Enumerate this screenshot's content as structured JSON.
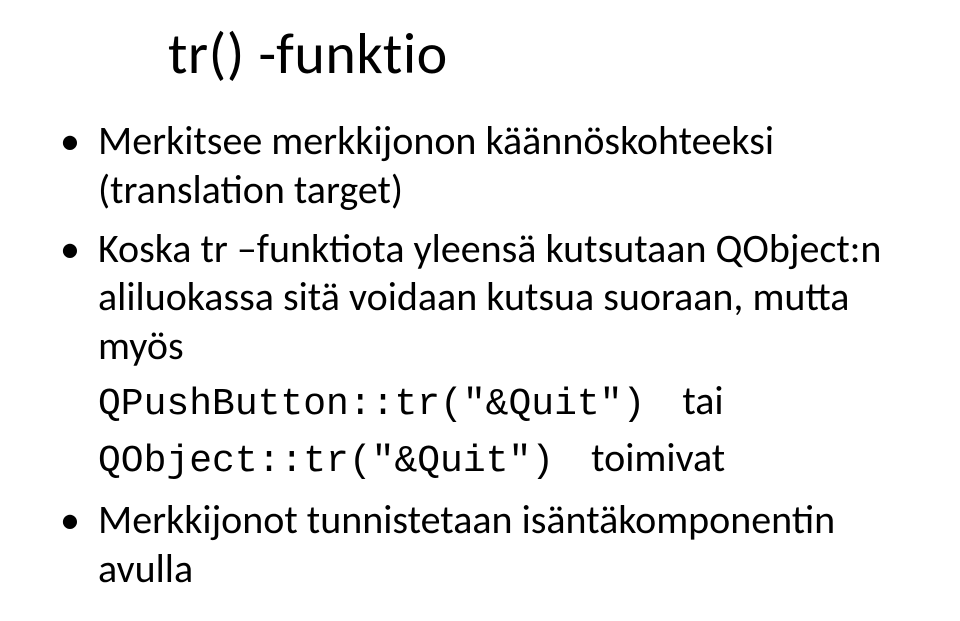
{
  "title": "tr() -funktio",
  "bullets": {
    "b1": "Merkitsee merkkijonon käännöskohteeksi (translation target)",
    "b2_line1": "Koska tr –funktiota yleensä kutsutaan QObject:n aliluokassa sitä voidaan kutsua suoraan, mutta myös",
    "b2_code1": "QPushButton::tr(\"&Quit\")",
    "b2_tai": "tai",
    "b2_code2": "QObject::tr(\"&Quit\")",
    "b2_toimivat": "toimivat",
    "b3": "Merkkijonot tunnistetaan isäntäkomponentin avulla"
  }
}
